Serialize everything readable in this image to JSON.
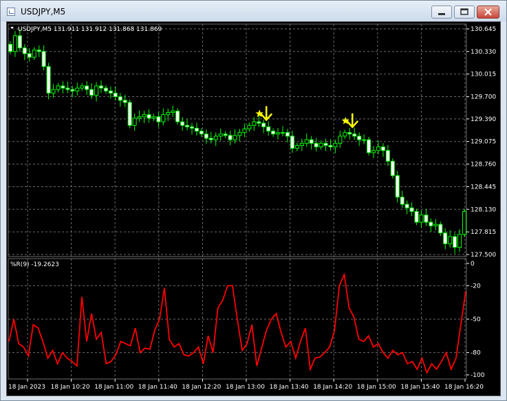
{
  "window": {
    "title": "USDJPY,M5",
    "app_icon": "chart-window-icon",
    "buttons": [
      "minimize-icon",
      "maximize-icon",
      "close-icon"
    ]
  },
  "colors": {
    "background": "#000000",
    "grid": "#6e6e6e",
    "candle": "#00ff00",
    "bull_body": "#000000",
    "bear_body": "#ffffff",
    "wpr_line": "#ff0000",
    "arrow": "#ffff00",
    "text": "#ffffff"
  },
  "price_panel": {
    "header": "USDJPY,M5  131.911 131.912 131.868 131.869",
    "price_labels": [
      "130.645",
      "130.330",
      "130.015",
      "129.700",
      "129.390",
      "129.075",
      "128.760",
      "128.445",
      "128.130",
      "127.815",
      "127.500"
    ]
  },
  "indicator_panel": {
    "header": "%R(9) -19.2623",
    "levels": [
      "0",
      "-20",
      "-50",
      "-80",
      "-100"
    ]
  },
  "time_labels": [
    "18 Jan 2023",
    "18 Jan 10:20",
    "18 Jan 11:00",
    "18 Jan 11:40",
    "18 Jan 12:20",
    "18 Jan 13:00",
    "18 Jan 13:40",
    "18 Jan 14:20",
    "18 Jan 15:00",
    "18 Jan 15:40",
    "18 Jan 16:20"
  ],
  "markers": [
    "sell-arrow-icon",
    "star-icon"
  ],
  "chart_data": [
    {
      "type": "candlestick",
      "title": "USDJPY,M5",
      "ylim": [
        127.5,
        130.645
      ],
      "close": [
        130.33,
        130.55,
        130.38,
        130.3,
        130.25,
        130.35,
        130.33,
        130.12,
        129.75,
        129.8,
        129.85,
        129.82,
        129.8,
        129.78,
        129.82,
        129.85,
        129.8,
        129.72,
        129.85,
        129.82,
        129.78,
        129.75,
        129.7,
        129.65,
        129.62,
        129.3,
        129.4,
        129.42,
        129.45,
        129.4,
        129.42,
        129.35,
        129.45,
        129.48,
        129.5,
        129.35,
        129.3,
        129.28,
        129.26,
        129.22,
        129.18,
        129.12,
        129.1,
        129.15,
        129.18,
        129.16,
        129.1,
        129.16,
        129.2,
        129.25,
        129.3,
        129.35,
        129.33,
        129.28,
        129.22,
        129.18,
        129.2,
        129.2,
        129.15,
        128.98,
        129.02,
        129.05,
        129.1,
        129.05,
        129.0,
        129.05,
        129.02,
        129.0,
        129.05,
        129.15,
        129.2,
        129.18,
        129.15,
        129.1,
        129.1,
        128.92,
        128.95,
        129.0,
        128.95,
        128.8,
        128.6,
        128.3,
        128.2,
        128.15,
        128.1,
        127.95,
        128.05,
        127.95,
        127.9,
        127.92,
        127.8,
        127.65,
        127.75,
        127.6,
        127.78,
        128.1
      ],
      "arrows": [
        {
          "type": "sell",
          "bar": 53
        },
        {
          "type": "sell",
          "bar": 71
        }
      ]
    },
    {
      "type": "line",
      "title": "%R(9)",
      "ylim": [
        -100,
        0
      ],
      "series": [
        {
          "name": "%R(9)",
          "values": [
            -70,
            -50,
            -72,
            -75,
            -83,
            -55,
            -58,
            -70,
            -85,
            -78,
            -90,
            -80,
            -85,
            -88,
            -92,
            -30,
            -70,
            -45,
            -68,
            -62,
            -90,
            -88,
            -82,
            -70,
            -72,
            -74,
            -58,
            -80,
            -76,
            -77,
            -60,
            -50,
            -22,
            -68,
            -75,
            -72,
            -82,
            -83,
            -80,
            -75,
            -90,
            -65,
            -80,
            -40,
            -33,
            -20,
            -20,
            -50,
            -78,
            -72,
            -55,
            -92,
            -76,
            -60,
            -50,
            -45,
            -62,
            -75,
            -70,
            -85,
            -70,
            -58,
            -95,
            -85,
            -84,
            -80,
            -75,
            -60,
            -20,
            -10,
            -40,
            -48,
            -68,
            -70,
            -65,
            -75,
            -72,
            -80,
            -85,
            -78,
            -82,
            -80,
            -90,
            -88,
            -95,
            -85,
            -98,
            -90,
            -95,
            -88,
            -80,
            -95,
            -85,
            -55,
            -25
          ]
        }
      ]
    }
  ]
}
